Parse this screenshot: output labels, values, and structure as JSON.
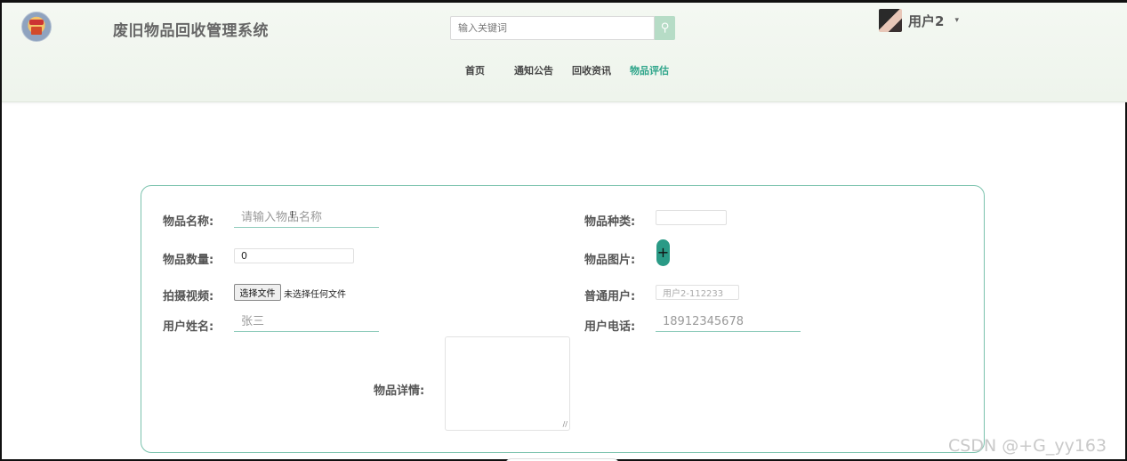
{
  "header": {
    "site_title": "废旧物品回收管理系统",
    "search_placeholder": "输入关键词",
    "user_name": "用户2",
    "nav": [
      "首页",
      "通知公告",
      "回收资讯",
      "物品评估"
    ],
    "active_nav": "物品评估"
  },
  "form": {
    "item_name_label": "物品名称:",
    "item_name_placeholder": "请输入物品名称",
    "item_type_label": "物品种类:",
    "item_type_value": "",
    "item_quantity_label": "物品数量:",
    "item_quantity_value": "0",
    "item_image_label": "物品图片:",
    "video_label": "拍摄视频:",
    "file_button_label": "选择文件",
    "file_status": "未选择任何文件",
    "normal_user_label": "普通用户:",
    "normal_user_value": "用户2-112233",
    "user_fullname_label": "用户姓名:",
    "user_fullname_placeholder": "张三",
    "user_phone_label": "用户电话:",
    "user_phone_placeholder": "18912345678",
    "item_detail_label": "物品详情:"
  },
  "watermark": "CSDN @+G_yy163",
  "colors": {
    "accent": "#2ea58a",
    "header_bg": "#f0f6ee",
    "card_border": "#7ac2ad"
  }
}
